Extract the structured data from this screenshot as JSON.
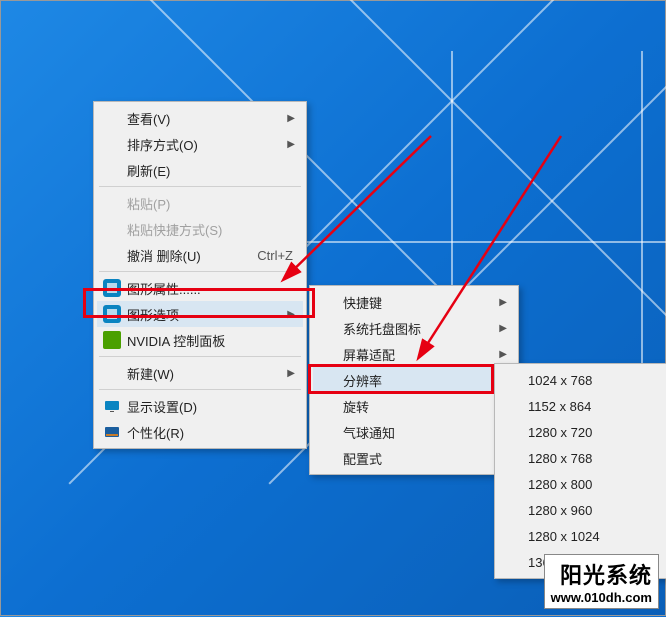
{
  "menu1": {
    "items": [
      {
        "label": "查看(V)",
        "has_sub": true
      },
      {
        "label": "排序方式(O)",
        "has_sub": true
      },
      {
        "label": "刷新(E)"
      },
      {
        "sep": true
      },
      {
        "label": "粘贴(P)",
        "disabled": true
      },
      {
        "label": "粘贴快捷方式(S)",
        "disabled": true
      },
      {
        "label": "撤消 删除(U)",
        "shortcut": "Ctrl+Z"
      },
      {
        "sep": true
      },
      {
        "label": "图形属性......",
        "icon": "intel"
      },
      {
        "label": "图形选项",
        "icon": "intel",
        "has_sub": true,
        "highlighted": true
      },
      {
        "label": "NVIDIA 控制面板",
        "icon": "nvidia"
      },
      {
        "sep": true
      },
      {
        "label": "新建(W)",
        "has_sub": true
      },
      {
        "sep": true
      },
      {
        "label": "显示设置(D)",
        "icon": "display"
      },
      {
        "label": "个性化(R)",
        "icon": "personalize"
      }
    ]
  },
  "menu2": {
    "items": [
      {
        "label": "快捷键",
        "has_sub": true
      },
      {
        "label": "系统托盘图标",
        "has_sub": true
      },
      {
        "label": "屏幕适配",
        "has_sub": true
      },
      {
        "label": "分辨率",
        "has_sub": true,
        "highlighted": true
      },
      {
        "label": "旋转",
        "has_sub": true
      },
      {
        "label": "气球通知",
        "has_sub": true
      },
      {
        "label": "配置式",
        "has_sub": true
      }
    ]
  },
  "menu3": {
    "items": [
      {
        "label": "1024 x 768"
      },
      {
        "label": "1152 x 864"
      },
      {
        "label": "1280 x 720"
      },
      {
        "label": "1280 x 768"
      },
      {
        "label": "1280 x 800"
      },
      {
        "label": "1280 x 960"
      },
      {
        "label": "1280 x 1024"
      },
      {
        "label": "1360 x 768"
      }
    ]
  },
  "highlight1": {
    "label": "图形选项 highlight"
  },
  "highlight2": {
    "label": "分辨率 highlight"
  },
  "watermark": {
    "line1": "阳光系统",
    "line2": "www.010dh.com"
  }
}
